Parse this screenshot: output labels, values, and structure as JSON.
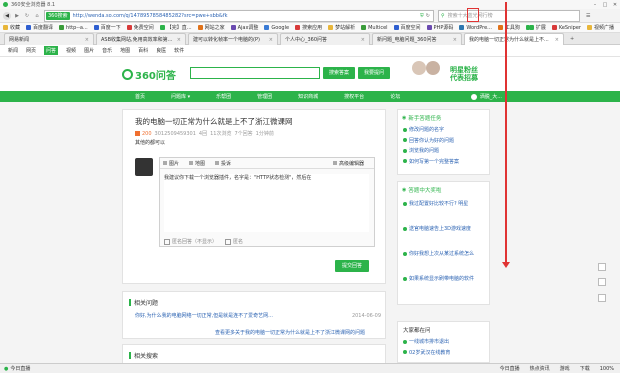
{
  "titlebar": {
    "title": "360安全浏览器 8.1"
  },
  "navbar": {
    "brand": "360搜索",
    "url": "http://wenda.so.com/q/1478957858485282?src=pwe+sbb&fk",
    "search_placeholder": "搜索十大蓝光网行榜",
    "menu_label": "菜单"
  },
  "bookmarks": [
    {
      "label": "收藏",
      "color": "#e8b63a"
    },
    {
      "label": "百度翻译",
      "color": "#2f5fd0"
    },
    {
      "label": "http--a...",
      "color": "#3a9c3a"
    },
    {
      "label": "百度一下",
      "color": "#2f5fd0"
    },
    {
      "label": "免费空间",
      "color": "#d83a3a"
    },
    {
      "label": "【完】直...",
      "color": "#2cb34a"
    },
    {
      "label": "网站之家",
      "color": "#e0721a"
    },
    {
      "label": "Ajax调整",
      "color": "#6a4ab0"
    },
    {
      "label": "Google",
      "color": "#3a7bd5"
    },
    {
      "label": "搜索应用",
      "color": "#d83a3a"
    },
    {
      "label": "梦站解析",
      "color": "#e8b63a"
    },
    {
      "label": "Multicel",
      "color": "#3a9c3a"
    },
    {
      "label": "百度空间",
      "color": "#2f5fd0"
    },
    {
      "label": "PHP源码",
      "color": "#6a4ab0"
    },
    {
      "label": "WordPre...",
      "color": "#2f78b0"
    },
    {
      "label": "工具狗",
      "color": "#e0721a"
    },
    {
      "label": "IT技术资",
      "color": "#2cb34a"
    }
  ],
  "bookmarks_right": [
    {
      "label": "扩展",
      "color": "#2cb34a"
    },
    {
      "label": "KeSniper",
      "color": "#d83a3a"
    },
    {
      "label": "视频广播",
      "color": "#e8b63a"
    }
  ],
  "tabs": [
    {
      "label": "网易新闻",
      "active": false
    },
    {
      "label": "ASB收集网站,免用高效率和第...",
      "active": false
    },
    {
      "label": "建可以转化帧率一个电脑的(P)",
      "active": false
    },
    {
      "label": "个人中心_360问答",
      "active": false
    },
    {
      "label": "新问题_电脑问题_360问答",
      "active": false
    },
    {
      "label": "我的电脑一切正常为什么就是上不...",
      "active": true
    }
  ],
  "sitenav": [
    "新闻",
    "网页",
    "问答",
    "视频",
    "图片",
    "音乐",
    "地图",
    "百科",
    "良医",
    "软件"
  ],
  "sitenav_active": 2,
  "header": {
    "logo_text": "360问答",
    "ask_button": "搜索答案",
    "answer_button": "我要提问",
    "banner_line1": "明星粉丝",
    "banner_line2": "代表招募"
  },
  "greennav": {
    "items": [
      "首页",
      "问题库 ▾",
      "乐帮团",
      "管理团",
      "知识商城",
      "搜权平台",
      "论坛"
    ],
    "user": "洒脱_大..."
  },
  "question": {
    "title": "我的电脑一切正常为什么就是上不了浙江微课网",
    "meta_user": "200",
    "meta_id": "3012509459301",
    "meta_time": "4回",
    "meta_views": "11次浏览",
    "meta_reply": "7个回答",
    "meta_actions": "1分钟前",
    "body": "其他的都可以",
    "editor_tools": [
      "图片",
      "地图",
      "投诉",
      "高级编辑器"
    ],
    "answer_text": "我建议你下载一个浏览器插件，名字是：\"HTTP状态检测\"，然后在",
    "opt_anonymous": "匿名回答（不显示）",
    "opt_other": "匿名",
    "submit": "提交回答"
  },
  "related": {
    "title": "相关问题",
    "items": [
      {
        "text": "你好,为什么我的电脑网络一切正常,但是就是连不了爱奇艺网...",
        "date": "2014-06-09"
      }
    ],
    "more": "查看更多关于我的电脑一切正常为什么就是上不了浙江微课网的问题"
  },
  "search_related": {
    "title": "相关搜索"
  },
  "sidebar": {
    "task_title": "新手答题任务",
    "task_items": [
      "修改问题的名字",
      "回答你认为好的问题",
      "浏览我的问题",
      "如何写第一个完整答案"
    ],
    "answer_title": "答题中大奖啦",
    "answer_items": [
      "我过配置好比较不行? 明星",
      "送官电脑速告上3D游戏速度",
      "你好我想上次从某过系统怎么",
      "如果系统显示刷带电脑的软件"
    ],
    "recent_title": "大家都在问",
    "recent_items": [
      "一线城市排市退出",
      "02岁武汉在线教育"
    ]
  },
  "status": {
    "left": "今日直播",
    "right_items": [
      "今日直播",
      "热点资讯",
      "游戏",
      "下载",
      "100%"
    ]
  },
  "colors": {
    "brand_green": "#2cb34a",
    "link_blue": "#2d64b3",
    "annotation_red": "#e03333"
  }
}
